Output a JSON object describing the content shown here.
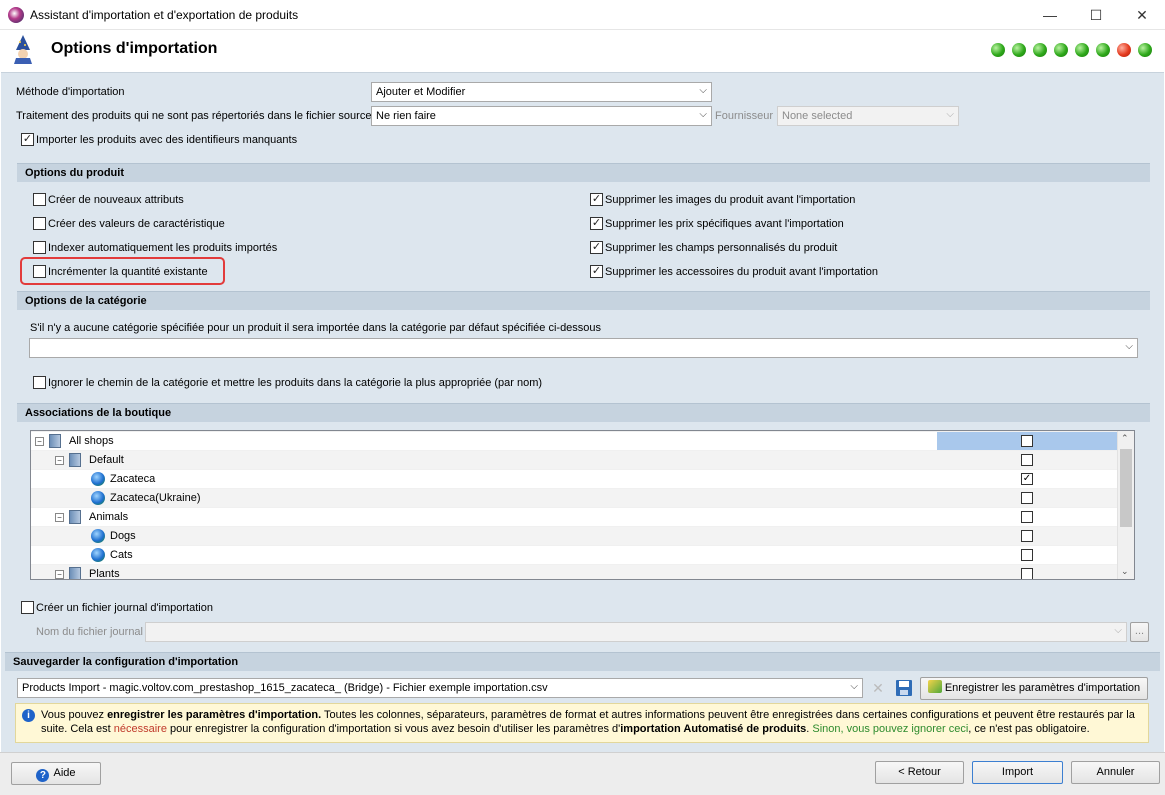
{
  "window": {
    "title": "Assistant d'importation et d'exportation de produits",
    "controls": [
      "—",
      "☐",
      "✕"
    ]
  },
  "header": {
    "title": "Options d'importation",
    "steps": [
      "done",
      "done",
      "done",
      "done",
      "done",
      "done",
      "done",
      "current",
      "done"
    ]
  },
  "import": {
    "method_label": "Méthode d'importation",
    "method_value": "Ajouter et Modifier",
    "untreated_label": "Traitement des produits qui ne sont pas répertoriés dans le fichier source",
    "untreated_value": "Ne rien faire",
    "supplier_label": "Fournisseur",
    "supplier_value": "None selected",
    "missing_ids_label": "Importer les produits avec des identifieurs manquants",
    "missing_ids_checked": true
  },
  "product_options": {
    "title": "Options du produit",
    "left": [
      {
        "label": "Créer de nouveaux attributs",
        "checked": false
      },
      {
        "label": "Créer des valeurs de caractéristique",
        "checked": false
      },
      {
        "label": "Indexer automatiquement les produits importés",
        "checked": false
      },
      {
        "label": "Incrémenter la quantité existante",
        "checked": false
      }
    ],
    "right": [
      {
        "label": "Supprimer les images du produit avant l'importation",
        "checked": true
      },
      {
        "label": "Supprimer les prix spécifiques avant l'importation",
        "checked": true
      },
      {
        "label": "Supprimer les champs personnalisés du produit",
        "checked": true
      },
      {
        "label": "Supprimer les accessoires du produit avant l'importation",
        "checked": true
      }
    ]
  },
  "category_options": {
    "title": "Options de la catégorie",
    "description": "S'il n'y a aucune catégorie spécifiée pour un produit il sera importée dans la catégorie par défaut spécifiée ci-dessous",
    "default_category": "",
    "ignore_path_label": "Ignorer le chemin de la catégorie et mettre les produits dans la catégorie la plus appropriée (par nom)",
    "ignore_path_checked": false
  },
  "shop_assoc": {
    "title": "Associations de la boutique",
    "rows": [
      {
        "label": "All shops",
        "kind": "root",
        "checked": false
      },
      {
        "label": "Default",
        "kind": "group",
        "checked": false
      },
      {
        "label": "Zacateca",
        "kind": "shop",
        "checked": true
      },
      {
        "label": "Zacateca(Ukraine)",
        "kind": "shop",
        "checked": false
      },
      {
        "label": "Animals",
        "kind": "group",
        "checked": false
      },
      {
        "label": "Dogs",
        "kind": "shop",
        "checked": false
      },
      {
        "label": "Cats",
        "kind": "shop",
        "checked": false
      },
      {
        "label": "Plants",
        "kind": "group",
        "checked": false
      }
    ]
  },
  "log": {
    "create_label": "Créer un fichier journal d'importation",
    "create_checked": false,
    "filename_label": "Nom du fichier journal",
    "filename_value": "",
    "browse": "..."
  },
  "save": {
    "title": "Sauvegarder la configuration d'importation",
    "config_value": "Products Import - magic.voltov.com_prestashop_1615_zacateca_ (Bridge) - Fichier exemple importation.csv",
    "save_button": "Enregistrer les paramètres d'importation",
    "info_parts": {
      "p1": "Vous pouvez ",
      "p2": "enregistrer les paramètres d'importation.",
      "p3": " Toutes les colonnes, séparateurs, paramètres de format et autres informations peuvent être enregistrées dans certaines configurations et peuvent être restaurés par la suite. Cela est ",
      "p4": "nécessaire",
      "p5": " pour enregistrer la configuration d'importation si vous avez besoin d'utiliser les paramètres d'",
      "p6": "importation Automatisé de produits",
      "p7": ". ",
      "p8": "Sinon, vous pouvez ignorer ceci",
      ", p9": "",
      "p9": ", ce n'est pas obligatoire."
    }
  },
  "footer": {
    "help": "Aide",
    "back": "< Retour",
    "import": "Import",
    "cancel": "Annuler"
  },
  "colors": {
    "section_bg": "#c6d3df",
    "main_bg": "#dde6ee",
    "highlight": "#e23b3b",
    "info_red": "#c0392b",
    "info_green": "#2e8b2e"
  }
}
